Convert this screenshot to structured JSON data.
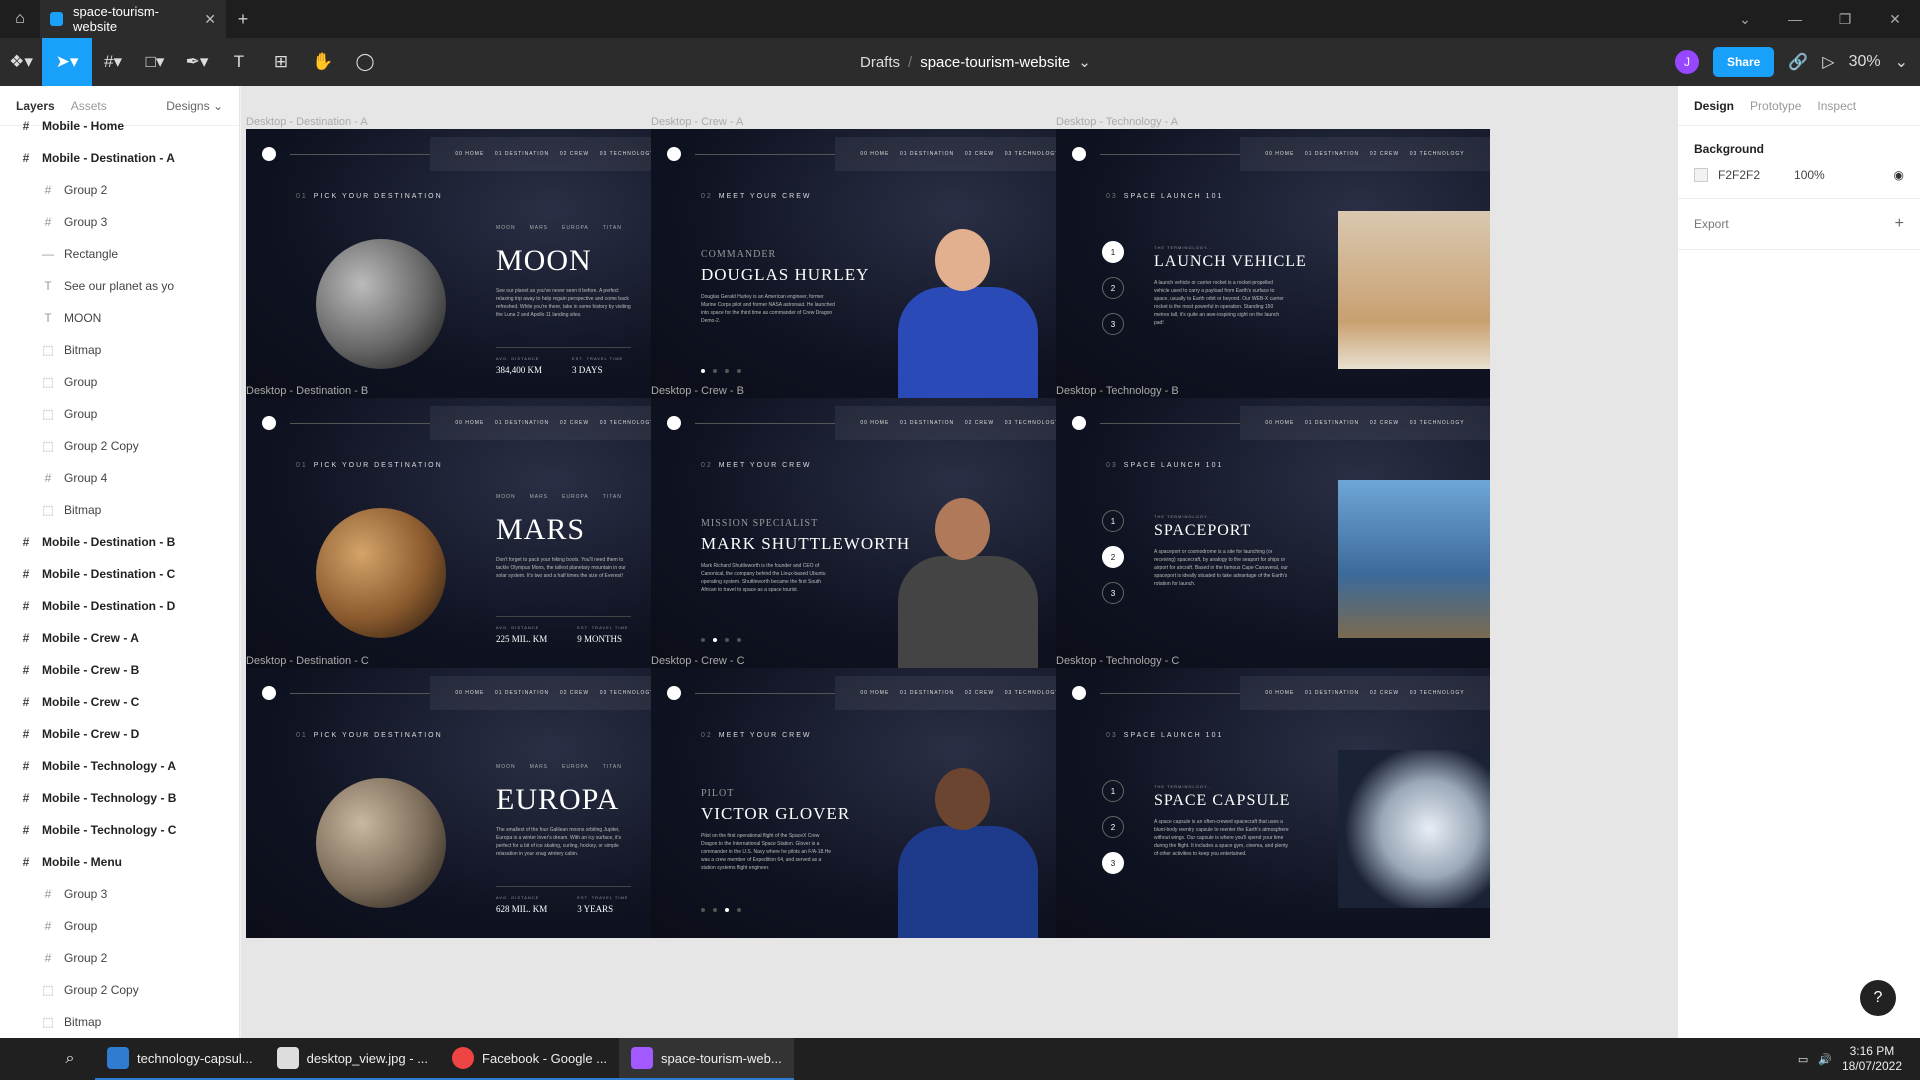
{
  "browser": {
    "tab_title": "space-tourism-website",
    "new_tab": "+",
    "close": "✕"
  },
  "toolbar": {
    "drafts": "Drafts",
    "separator": "/",
    "file_name": "space-tourism-website",
    "avatar": "J",
    "share": "Share",
    "zoom": "30%"
  },
  "left_panel": {
    "tabs": [
      "Layers",
      "Assets"
    ],
    "pages": "Designs",
    "layers": [
      {
        "label": "Mobile - Home",
        "level": 0,
        "icon": "#"
      },
      {
        "label": "Mobile - Destination - A",
        "level": 0,
        "icon": "#"
      },
      {
        "label": "Group 2",
        "level": 1,
        "icon": "#"
      },
      {
        "label": "Group 3",
        "level": 1,
        "icon": "#"
      },
      {
        "label": "Rectangle",
        "level": 1,
        "icon": "—"
      },
      {
        "label": "See our planet as yo",
        "level": 1,
        "icon": "T"
      },
      {
        "label": "MOON",
        "level": 1,
        "icon": "T"
      },
      {
        "label": "Bitmap",
        "level": 1,
        "icon": "⬚"
      },
      {
        "label": "Group",
        "level": 1,
        "icon": "⬚"
      },
      {
        "label": "Group",
        "level": 1,
        "icon": "⬚"
      },
      {
        "label": "Group 2 Copy",
        "level": 1,
        "icon": "⬚"
      },
      {
        "label": "Group 4",
        "level": 1,
        "icon": "#"
      },
      {
        "label": "Bitmap",
        "level": 1,
        "icon": "⬚"
      },
      {
        "label": "Mobile - Destination - B",
        "level": 0,
        "icon": "#"
      },
      {
        "label": "Mobile - Destination - C",
        "level": 0,
        "icon": "#"
      },
      {
        "label": "Mobile - Destination - D",
        "level": 0,
        "icon": "#"
      },
      {
        "label": "Mobile - Crew - A",
        "level": 0,
        "icon": "#"
      },
      {
        "label": "Mobile - Crew - B",
        "level": 0,
        "icon": "#"
      },
      {
        "label": "Mobile - Crew - C",
        "level": 0,
        "icon": "#"
      },
      {
        "label": "Mobile - Crew - D",
        "level": 0,
        "icon": "#"
      },
      {
        "label": "Mobile - Technology - A",
        "level": 0,
        "icon": "#"
      },
      {
        "label": "Mobile - Technology - B",
        "level": 0,
        "icon": "#"
      },
      {
        "label": "Mobile - Technology - C",
        "level": 0,
        "icon": "#"
      },
      {
        "label": "Mobile - Menu",
        "level": 0,
        "icon": "#"
      },
      {
        "label": "Group 3",
        "level": 1,
        "icon": "#"
      },
      {
        "label": "Group",
        "level": 1,
        "icon": "#"
      },
      {
        "label": "Group 2",
        "level": 1,
        "icon": "#"
      },
      {
        "label": "Group 2 Copy",
        "level": 1,
        "icon": "⬚"
      },
      {
        "label": "Bitmap",
        "level": 1,
        "icon": "⬚"
      }
    ]
  },
  "nav": [
    "00 HOME",
    "01 DESTINATION",
    "02 CREW",
    "03 TECHNOLOGY"
  ],
  "destinations": {
    "eyebrow_num": "01",
    "eyebrow": "PICK YOUR DESTINATION",
    "subtabs": [
      "MOON",
      "MARS",
      "EUROPA",
      "TITAN"
    ],
    "distance_label": "AVG. DISTANCE",
    "time_label": "EST. TRAVEL TIME",
    "frames": [
      {
        "label": "Desktop - Destination - A",
        "title": "MOON",
        "desc": "See our planet as you've never seen it before. A perfect relaxing trip away to help regain perspective and come back refreshed. While you're there, take in some history by visiting the Luna 2 and Apollo 11 landing sites.",
        "distance": "384,400 KM",
        "time": "3 DAYS"
      },
      {
        "label": "Desktop - Destination - B",
        "title": "MARS",
        "desc": "Don't forget to pack your hiking boots. You'll need them to tackle Olympus Mons, the tallest planetary mountain in our solar system. It's two and a half times the size of Everest!",
        "distance": "225 MIL. KM",
        "time": "9 MONTHS"
      },
      {
        "label": "Desktop - Destination - C",
        "title": "EUROPA",
        "desc": "The smallest of the four Galilean moons orbiting Jupiter, Europa is a winter lover's dream. With an icy surface, it's perfect for a bit of ice skating, curling, hockey, or simple relaxation in your snug wintery cabin.",
        "distance": "628 MIL. KM",
        "time": "3 YEARS"
      }
    ]
  },
  "crew": {
    "eyebrow_num": "02",
    "eyebrow": "MEET YOUR CREW",
    "frames": [
      {
        "label": "Desktop - Crew - A",
        "role": "COMMANDER",
        "name": "DOUGLAS HURLEY",
        "bio": "Douglas Gerald Hurley is an American engineer, former Marine Corps pilot and former NASA astronaut. He launched into space for the third time as commander of Crew Dragon Demo-2."
      },
      {
        "label": "Desktop - Crew -  B",
        "role": "MISSION SPECIALIST",
        "name": "MARK SHUTTLEWORTH",
        "bio": "Mark Richard Shuttleworth is the founder and CEO of Canonical, the company behind the Linux-based Ubuntu operating system. Shuttleworth became the first South African to travel to space as a space tourist."
      },
      {
        "label": "Desktop - Crew -  C",
        "role": "PILOT",
        "name": "VICTOR GLOVER",
        "bio": "Pilot on the first operational flight of the SpaceX Crew Dragon to the International Space Station. Glover is a commander in the U.S. Navy where he pilots an F/A-18.He was a crew member of Expedition 64, and served as a station systems flight engineer."
      }
    ]
  },
  "technology": {
    "eyebrow_num": "03",
    "eyebrow": "SPACE LAUNCH 101",
    "term": "THE TERMINOLOGY...",
    "numbers": [
      "1",
      "2",
      "3"
    ],
    "frames": [
      {
        "label": "Desktop - Technology - A",
        "title": "LAUNCH VEHICLE",
        "desc": "A launch vehicle or carrier rocket is a rocket-propelled vehicle used to carry a payload from Earth's surface to space, usually to Earth orbit or beyond. Our WEB-X carrier rocket is the most powerful in operation. Standing 150 metres tall, it's quite an awe-inspiring sight on the launch pad!"
      },
      {
        "label": "Desktop - Technology - B",
        "title": "SPACEPORT",
        "desc": "A spaceport or cosmodrome is a site for launching (or receiving) spacecraft, by analogy to the seaport for ships or airport for aircraft. Based in the famous Cape Canaveral, our spaceport is ideally situated to take advantage of the Earth's rotation for launch."
      },
      {
        "label": "Desktop - Technology - C",
        "title": "SPACE CAPSULE",
        "desc": "A space capsule is an often-crewed spacecraft that uses a blunt-body reentry capsule to reenter the Earth's atmosphere without wings. Our capsule is where you'll spend your time during the flight. It includes a space gym, cinema, and plenty of other activities to keep you entertained."
      }
    ]
  },
  "right_panel": {
    "tabs": [
      "Design",
      "Prototype",
      "Inspect"
    ],
    "background_title": "Background",
    "bg_hex": "F2F2F2",
    "bg_opacity": "100%",
    "export": "Export"
  },
  "help": "?",
  "taskbar": {
    "items": [
      "technology-capsul...",
      "desktop_view.jpg - ...",
      "Facebook - Google ...",
      "space-tourism-web..."
    ],
    "time": "3:16 PM",
    "date": "18/07/2022"
  }
}
